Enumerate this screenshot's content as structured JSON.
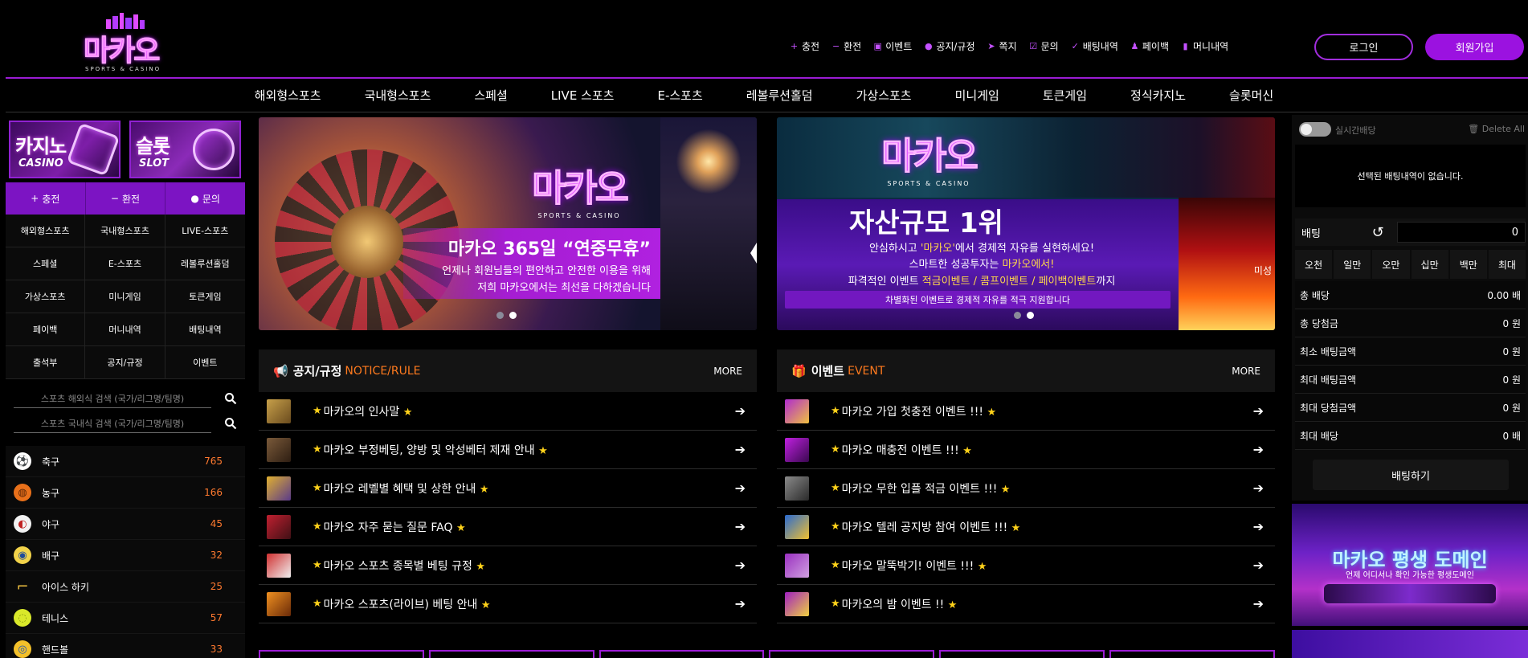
{
  "brand": {
    "name": "마카오",
    "tagline": "SPORTS & CASINO",
    "accent": "#9b12e0",
    "highlight": "#ff7a1e"
  },
  "topnav": [
    {
      "icon": "plus-icon",
      "label": "충전"
    },
    {
      "icon": "minus-icon",
      "label": "환전"
    },
    {
      "icon": "calendar-icon",
      "label": "이벤트"
    },
    {
      "icon": "info-icon",
      "label": "공지/규정"
    },
    {
      "icon": "paper-plane-icon",
      "label": "쪽지"
    },
    {
      "icon": "checkbox-icon",
      "label": "문의"
    },
    {
      "icon": "check-icon",
      "label": "배팅내역"
    },
    {
      "icon": "user-icon",
      "label": "페이백"
    },
    {
      "icon": "wallet-icon",
      "label": "머니내역"
    }
  ],
  "auth": {
    "login": "로그인",
    "join": "회원가입"
  },
  "mainnav": [
    "해외형스포츠",
    "국내형스포츠",
    "스페셜",
    "LIVE 스포츠",
    "E-스포츠",
    "레볼루션홀덤",
    "가상스포츠",
    "미니게임",
    "토큰게임",
    "정식카지노",
    "슬롯머신"
  ],
  "promos": [
    {
      "big": "카지노",
      "small": "CASINO"
    },
    {
      "big": "슬롯",
      "small": "SLOT"
    }
  ],
  "quick": [
    {
      "icon": "plus-icon",
      "label": "충전"
    },
    {
      "icon": "minus-icon",
      "label": "환전"
    },
    {
      "icon": "info-icon",
      "label": "문의"
    }
  ],
  "side_grid": [
    "해외형스포츠",
    "국내형스포츠",
    "LIVE-스포츠",
    "스페셜",
    "E-스포츠",
    "레볼루션홀덤",
    "가상스포츠",
    "미니게임",
    "토큰게임",
    "페이백",
    "머니내역",
    "배팅내역",
    "출석부",
    "공지/규정",
    "이벤트"
  ],
  "search": {
    "overseas_placeholder": "스포츠 해외식 검색 (국가/리그명/팀명)",
    "domestic_placeholder": "스포츠 국내식 검색 (국가/리그명/팀명)"
  },
  "sports": [
    {
      "icon": "soccer-ball-icon",
      "name": "축구",
      "count": "765"
    },
    {
      "icon": "basketball-icon",
      "name": "농구",
      "count": "166"
    },
    {
      "icon": "baseball-icon",
      "name": "야구",
      "count": "45"
    },
    {
      "icon": "volleyball-icon",
      "name": "배구",
      "count": "32"
    },
    {
      "icon": "hockey-stick-icon",
      "name": "아이스 하키",
      "count": "25"
    },
    {
      "icon": "tennis-ball-icon",
      "name": "테니스",
      "count": "57"
    },
    {
      "icon": "handball-icon",
      "name": "핸드볼",
      "count": "33"
    }
  ],
  "banner1": {
    "logo": "마카오",
    "tagline": "SPORTS & CASINO",
    "title": "마카오 365일 “연중무휴”",
    "line1": "언제나 회원님들의 편안하고 안전한 이용을 위해",
    "line2": "저희 마카오에서는 최선을 다하겠습니다"
  },
  "banner2": {
    "logo": "마카오",
    "tagline": "SPORTS & CASINO",
    "head": "자산규모 1위",
    "line1_a": "안심하시고 ",
    "line1_b": "'마카오'",
    "line1_c": "에서 경제적 자유를 실현하세요!",
    "line2_a": "스마트한 성공투자는 ",
    "line2_b": "마카오에서!",
    "line3_a": "파격적인 이벤트 ",
    "line3_b": "적금이벤트 / 콤프이벤트 / 페이백이벤트",
    "line3_c": "까지",
    "bar": "차별화된 이벤트로 경제적 자유를 적극 지원합니다",
    "peek": "미성"
  },
  "notice": {
    "title": "공지/규정",
    "title_en": "NOTICE/RULE",
    "more": "MORE",
    "items": [
      "마카오의 인사말",
      "마카오 부정베팅, 양방 및 악성베터 제재 안내",
      "마카오 레벨별 혜택 및 상한 안내",
      "마카오 자주 묻는 질문 FAQ",
      "마카오 스포츠 종목별 베팅 규정",
      "마카오 스포츠(라이브) 베팅 안내"
    ]
  },
  "event": {
    "title": "이벤트",
    "title_en": "EVENT",
    "more": "MORE",
    "items": [
      "마카오 가입 첫충전 이벤트 !!!",
      "마카오 매충전 이벤트 !!!",
      "마카오 무한 입플 적금 이벤트 !!!",
      "마카오 텔레 공지방 참여 이벤트 !!!",
      "마카오 말뚝박기! 이벤트 !!!",
      "마카오의 밤 이벤트 !! "
    ]
  },
  "slip": {
    "toggle_label": "실시간배당",
    "delete_all": "Delete All",
    "empty": "선택된 배팅내역이 없습니다.",
    "bet_label": "배팅",
    "bet_amount": "0",
    "chips": [
      "오천",
      "일만",
      "오만",
      "십만",
      "백만",
      "최대"
    ],
    "stats": [
      {
        "label": "총 배당",
        "value": "0.00 배"
      },
      {
        "label": "총 당첨금",
        "value": "0 원"
      },
      {
        "label": "최소 배팅금액",
        "value": "0 원"
      },
      {
        "label": "최대 배팅금액",
        "value": "0 원"
      },
      {
        "label": "최대 당첨금액",
        "value": "0 원"
      },
      {
        "label": "최대 배당",
        "value": "0 배"
      }
    ],
    "submit": "배팅하기"
  },
  "right_banner": {
    "title": "마카오 평생 도메인",
    "sub": "언제 어디서나 확인 가능한 평생도메인"
  }
}
